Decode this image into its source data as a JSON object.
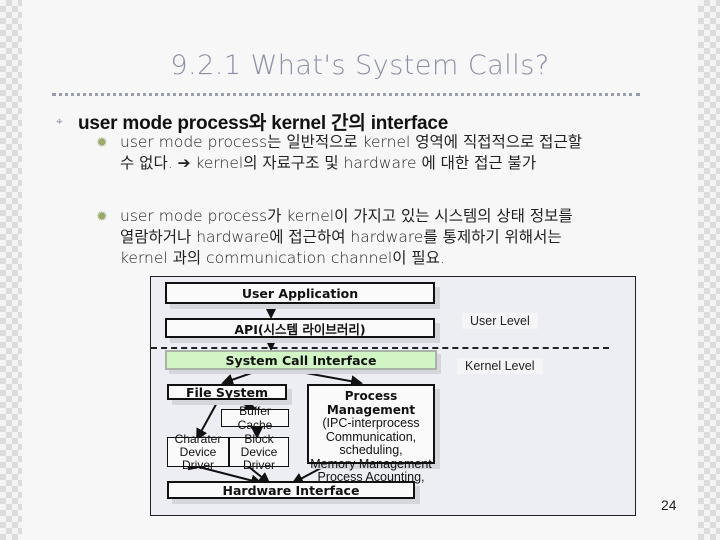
{
  "slide": {
    "title": "9.2.1 What's System Calls?",
    "page_number": "24",
    "bullets": [
      {
        "icon": "crosshair-bullet-icon",
        "text": "user mode process와 kernel 간의 interface",
        "children": [
          {
            "icon": "starburst-bullet-icon",
            "lines": [
              "user mode process는 일반적으로 kernel 영역에 직접적으로 접근할",
              "수 없다.  ➔ kernel의 자료구조 및 hardware 에 대한 접근 불가"
            ]
          },
          {
            "icon": "starburst-bullet-icon",
            "lines": [
              "user mode process가 kernel이 가지고 있는 시스템의 상태 정보를",
              "열람하거나 hardware에 접근하여 hardware를 통제하기 위해서는",
              "kernel 과의 communication channel이 필요."
            ]
          }
        ]
      }
    ]
  },
  "diagram": {
    "user_application": "User Application",
    "api": "API(시스템 라이브러리)",
    "system_call_interface": "System Call Interface",
    "file_system": "File System",
    "buffer_cache": "Buffer Cache",
    "character_device_driver": "Charater Device Driver",
    "character_line1": "Charater",
    "character_line2": "Device Driver",
    "block_line1": "Block",
    "block_line2": "Device Driver",
    "process_management": {
      "title": "Process Management",
      "lines": [
        "(IPC-interprocess",
        "Communication, scheduling,",
        "Memory Management",
        "Process Acounting, etc)"
      ]
    },
    "hardware_interface": "Hardware Interface",
    "user_level_label": "User Level",
    "kernel_level_label": "Kernel Level"
  }
}
